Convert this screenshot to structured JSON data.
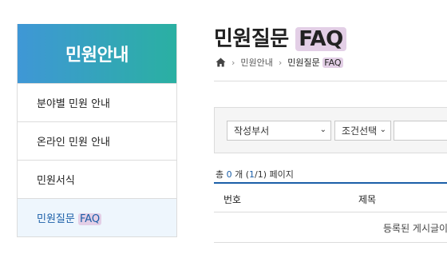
{
  "sidebar": {
    "title": "민원안내",
    "items": [
      {
        "label": "분야별 민원 안내"
      },
      {
        "label": "온라인 민원 안내"
      },
      {
        "label": "민원서식"
      },
      {
        "label_main": "민원질문 ",
        "label_hl": "FAQ"
      }
    ]
  },
  "title": {
    "main": "민원질문 ",
    "hl": "FAQ"
  },
  "breadcrumb": {
    "level1": "민원안내",
    "current_main": "민원질문 ",
    "current_hl": "FAQ"
  },
  "search": {
    "department_select": "작성부서",
    "condition_select": "조건선택",
    "keyword_value": ""
  },
  "count": {
    "prefix": "총 ",
    "total": "0",
    "unit": " 개 (",
    "page": "1",
    "slash": "/",
    "pages": "1",
    "suffix": ") 페이지"
  },
  "table": {
    "columns": [
      "번호",
      "제목"
    ],
    "empty_message": "등록된 게시글이"
  },
  "colors": {
    "accent": "#1b5fa8",
    "header_gradient_start": "#3f97d6",
    "header_gradient_end": "#2ab0a2",
    "highlight": "#e3cfe6"
  }
}
